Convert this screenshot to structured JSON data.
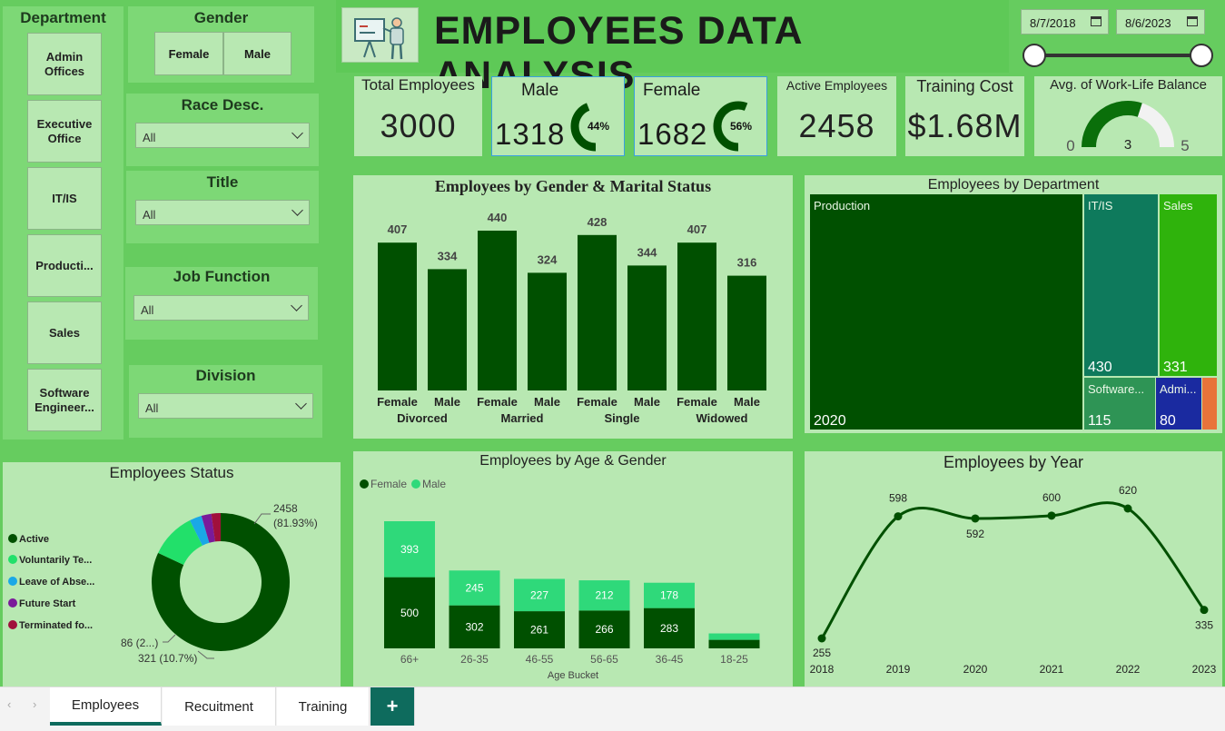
{
  "title": "EMPLOYEES DATA ANALYSIS",
  "date_range": {
    "start": "8/7/2018",
    "end": "8/6/2023"
  },
  "slicers": {
    "department": {
      "title": "Department",
      "items": [
        "Admin Offices",
        "Executive Office",
        "IT/IS",
        "Producti...",
        "Sales",
        "Software Engineer..."
      ]
    },
    "gender": {
      "title": "Gender",
      "items": [
        "Female",
        "Male"
      ]
    },
    "race": {
      "title": "Race Desc.",
      "value": "All"
    },
    "title_slicer": {
      "title": "Title",
      "value": "All"
    },
    "job_function": {
      "title": "Job Function",
      "value": "All"
    },
    "division": {
      "title": "Division",
      "value": "All"
    }
  },
  "kpis": {
    "total": {
      "label": "Total Employees",
      "value": "3000"
    },
    "male": {
      "label": "Male",
      "value": "1318",
      "pct": "44%",
      "fraction": 0.44
    },
    "female": {
      "label": "Female",
      "value": "1682",
      "pct": "56%",
      "fraction": 0.56
    },
    "active": {
      "label": "Active Employees",
      "value": "2458"
    },
    "training": {
      "label": "Training Cost",
      "value": "$1.68M"
    },
    "wlb": {
      "label": "Avg. of Work-Life Balance",
      "min": "0",
      "value": "3",
      "max": "5",
      "fraction": 0.6
    }
  },
  "colors": {
    "dark_green": "#005000",
    "light_green": "#2fd97a",
    "panel": "#b8e8b2",
    "bg": "#66cc5f"
  },
  "chart_data": [
    {
      "id": "gender_marital",
      "type": "bar",
      "title": "Employees by Gender & Marital Status",
      "categories": [
        "Female",
        "Male",
        "Female",
        "Male",
        "Female",
        "Male",
        "Female",
        "Male"
      ],
      "groups": [
        "Divorced",
        "Married",
        "Single",
        "Widowed"
      ],
      "values": [
        407,
        334,
        440,
        324,
        428,
        344,
        407,
        316
      ],
      "labels": [
        "407",
        "334",
        "440",
        "324",
        "428",
        "344",
        "407",
        "316"
      ]
    },
    {
      "id": "department_treemap",
      "type": "treemap",
      "title": "Employees by Department",
      "items": [
        {
          "name": "Production",
          "value": 2020,
          "label": "2020",
          "color": "#005000"
        },
        {
          "name": "IT/IS",
          "value": 430,
          "label": "430",
          "color": "#0e7a5c"
        },
        {
          "name": "Sales",
          "value": 331,
          "label": "331",
          "color": "#2fb30c"
        },
        {
          "name": "Software...",
          "value": 115,
          "label": "115",
          "color": "#2e9455"
        },
        {
          "name": "Admi...",
          "value": 80,
          "label": "80",
          "color": "#1a2aa0"
        },
        {
          "name": "",
          "value": 24,
          "label": "",
          "color": "#e8733a"
        }
      ]
    },
    {
      "id": "employee_status",
      "type": "pie",
      "title": "Employees Status",
      "legend": [
        "Active",
        "Voluntarily Te...",
        "Leave of Abse...",
        "Future Start",
        "Terminated fo..."
      ],
      "values": [
        2458,
        321,
        86,
        70,
        65
      ],
      "colors": [
        "#005000",
        "#22e06a",
        "#1aa8e6",
        "#7a1a9a",
        "#a0103c"
      ],
      "annotations": [
        "2458",
        "(81.93%)",
        "321 (10.7%)",
        "86 (2...)"
      ]
    },
    {
      "id": "age_gender",
      "type": "bar",
      "title": "Employees by Age & Gender",
      "legend": [
        "Female",
        "Male"
      ],
      "xlabel": "Age Bucket",
      "categories": [
        "66+",
        "26-35",
        "46-55",
        "56-65",
        "36-45",
        "18-25"
      ],
      "series": [
        {
          "name": "Female",
          "values": [
            500,
            302,
            261,
            266,
            283,
            60
          ],
          "labels": [
            "500",
            "302",
            "261",
            "266",
            "283",
            ""
          ]
        },
        {
          "name": "Male",
          "values": [
            393,
            245,
            227,
            212,
            178,
            45
          ],
          "labels": [
            "393",
            "245",
            "227",
            "212",
            "178",
            ""
          ]
        }
      ]
    },
    {
      "id": "by_year",
      "type": "line",
      "title": "Employees by Year",
      "x": [
        "2018",
        "2019",
        "2020",
        "2021",
        "2022",
        "2023"
      ],
      "values": [
        255,
        598,
        592,
        600,
        620,
        335
      ],
      "labels": [
        "255",
        "598",
        "592",
        "600",
        "620",
        "335"
      ]
    }
  ],
  "tabs": [
    "Employees",
    "Recuitment",
    "Training"
  ],
  "add_tab": "+"
}
